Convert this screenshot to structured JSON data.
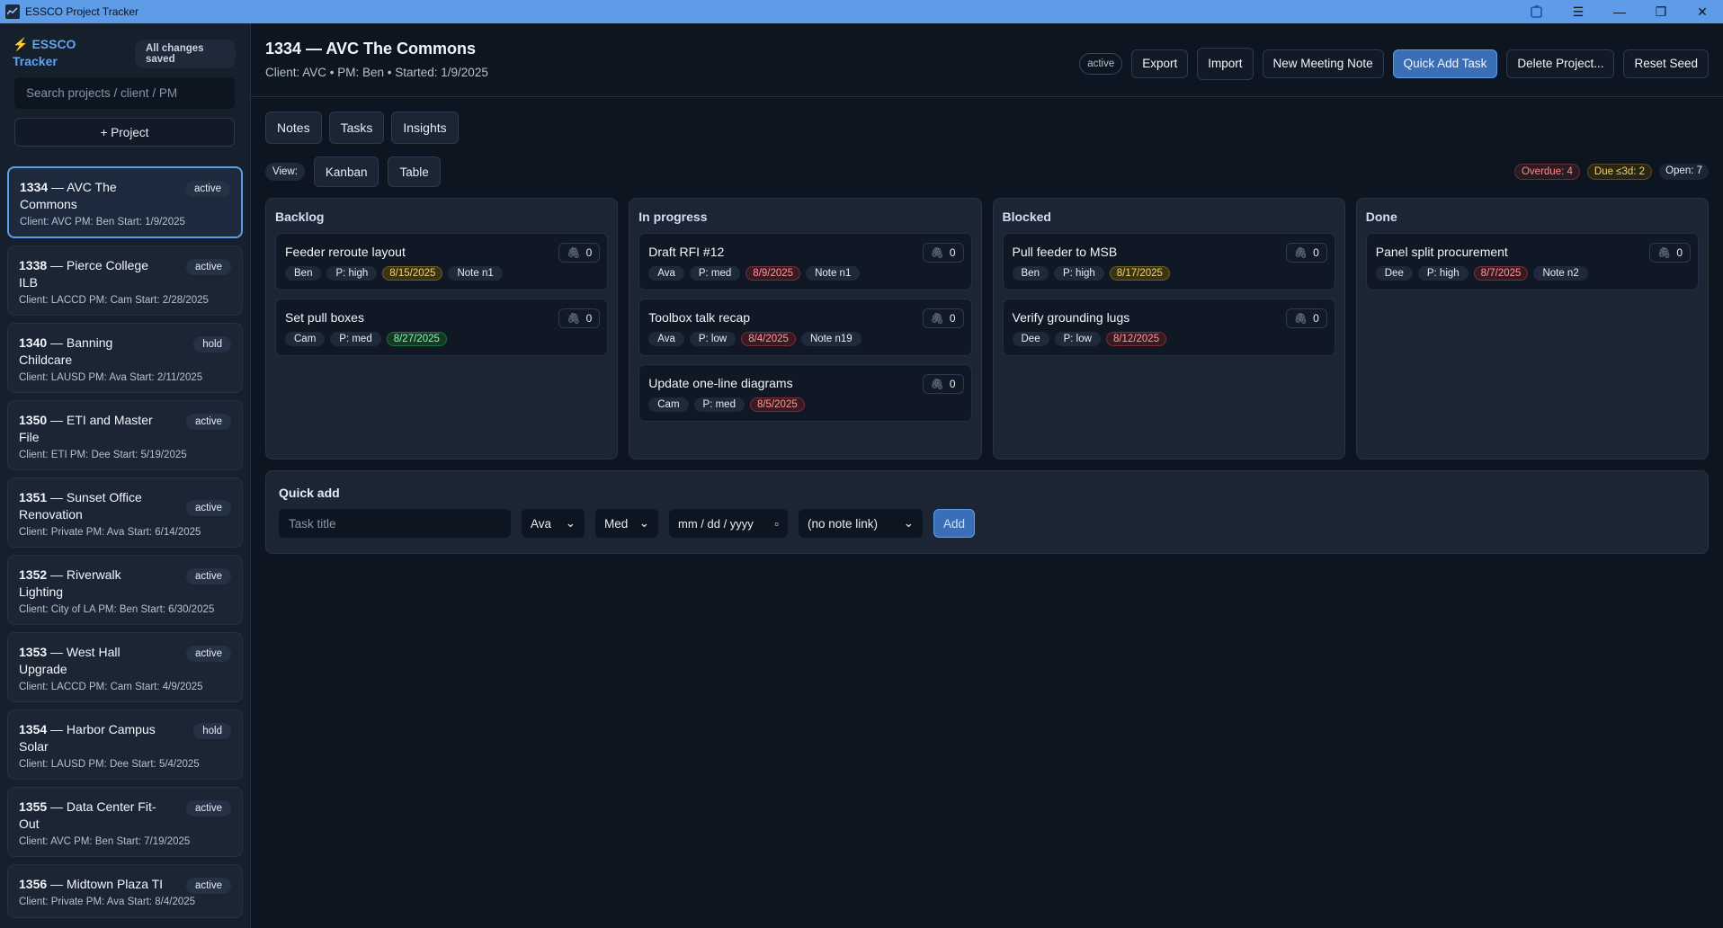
{
  "window": {
    "title": "ESSCO Project Tracker",
    "buttons": {
      "menu": "☰",
      "minimize": "—",
      "restore": "❐",
      "close": "✕"
    }
  },
  "sidebar": {
    "brand_line1": "ESSCO",
    "brand_line2": "Tracker",
    "saved_status": "All changes saved",
    "search_placeholder": "Search projects / client / PM",
    "add_project_label": "+ Project",
    "projects": [
      {
        "number": "1334",
        "name": "— AVC The Commons",
        "status": "active",
        "meta": "Client: AVC   PM: Ben   Start: 1/9/2025"
      },
      {
        "number": "1338",
        "name": "— Pierce College ILB",
        "status": "active",
        "meta": "Client: LACCD   PM: Cam   Start: 2/28/2025"
      },
      {
        "number": "1340",
        "name": "— Banning Childcare",
        "status": "hold",
        "meta": "Client: LAUSD   PM: Ava   Start: 2/11/2025"
      },
      {
        "number": "1350",
        "name": "— ETI and Master File",
        "status": "active",
        "meta": "Client: ETI   PM: Dee   Start: 5/19/2025"
      },
      {
        "number": "1351",
        "name": "— Sunset Office Renovation",
        "status": "active",
        "meta": "Client: Private   PM: Ava   Start: 6/14/2025"
      },
      {
        "number": "1352",
        "name": "— Riverwalk Lighting",
        "status": "active",
        "meta": "Client: City of LA   PM: Ben   Start: 6/30/2025"
      },
      {
        "number": "1353",
        "name": "— West Hall Upgrade",
        "status": "active",
        "meta": "Client: LACCD   PM: Cam   Start: 4/9/2025"
      },
      {
        "number": "1354",
        "name": "— Harbor Campus Solar",
        "status": "hold",
        "meta": "Client: LAUSD   PM: Dee   Start: 5/4/2025"
      },
      {
        "number": "1355",
        "name": "— Data Center Fit-Out",
        "status": "active",
        "meta": "Client: AVC   PM: Ben   Start: 7/19/2025"
      },
      {
        "number": "1356",
        "name": "— Midtown Plaza TI",
        "status": "active",
        "meta": "Client: Private   PM: Ava   Start: 8/4/2025"
      }
    ]
  },
  "header": {
    "title": "1334 — AVC The Commons",
    "subtitle": "Client: AVC • PM: Ben • Started: 1/9/2025",
    "status": "active",
    "buttons": {
      "export": "Export",
      "import": "Import",
      "new_meeting_note": "New Meeting Note",
      "quick_add_task": "Quick Add Task",
      "delete_project": "Delete Project...",
      "reset_seed": "Reset Seed"
    }
  },
  "tabs": {
    "notes": "Notes",
    "tasks": "Tasks",
    "insights": "Insights"
  },
  "view": {
    "label": "View:",
    "kanban": "Kanban",
    "table": "Table",
    "overdue": "Overdue: 4",
    "due_soon": "Due ≤3d: 2",
    "open": "Open: 7"
  },
  "board": {
    "columns": [
      {
        "title": "Backlog",
        "tasks": [
          {
            "title": "Feeder reroute layout",
            "attachments": "0",
            "owner": "Ben",
            "priority": "P: high",
            "date": "8/15/2025",
            "date_color": "yellow",
            "note": "Note n1"
          },
          {
            "title": "Set pull boxes",
            "attachments": "0",
            "owner": "Cam",
            "priority": "P: med",
            "date": "8/27/2025",
            "date_color": "green",
            "note": ""
          }
        ]
      },
      {
        "title": "In progress",
        "tasks": [
          {
            "title": "Draft RFI #12",
            "attachments": "0",
            "owner": "Ava",
            "priority": "P: med",
            "date": "8/9/2025",
            "date_color": "red",
            "note": "Note n1"
          },
          {
            "title": "Toolbox talk recap",
            "attachments": "0",
            "owner": "Ava",
            "priority": "P: low",
            "date": "8/4/2025",
            "date_color": "red",
            "note": "Note n19"
          },
          {
            "title": "Update one-line diagrams",
            "attachments": "0",
            "owner": "Cam",
            "priority": "P: med",
            "date": "8/5/2025",
            "date_color": "red",
            "note": ""
          }
        ]
      },
      {
        "title": "Blocked",
        "tasks": [
          {
            "title": "Pull feeder to MSB",
            "attachments": "0",
            "owner": "Ben",
            "priority": "P: high",
            "date": "8/17/2025",
            "date_color": "yellow",
            "note": ""
          },
          {
            "title": "Verify grounding lugs",
            "attachments": "0",
            "owner": "Dee",
            "priority": "P: low",
            "date": "8/12/2025",
            "date_color": "red",
            "note": ""
          }
        ]
      },
      {
        "title": "Done",
        "tasks": [
          {
            "title": "Panel split procurement",
            "attachments": "0",
            "owner": "Dee",
            "priority": "P: high",
            "date": "8/7/2025",
            "date_color": "red",
            "note": "Note n2"
          }
        ]
      }
    ]
  },
  "quick_add": {
    "title": "Quick add",
    "title_placeholder": "Task title",
    "owner_value": "Ava",
    "priority_value": "Med",
    "date_placeholder": "mm / dd / yyyy",
    "note_link_value": "(no note link)",
    "add_label": "Add"
  }
}
